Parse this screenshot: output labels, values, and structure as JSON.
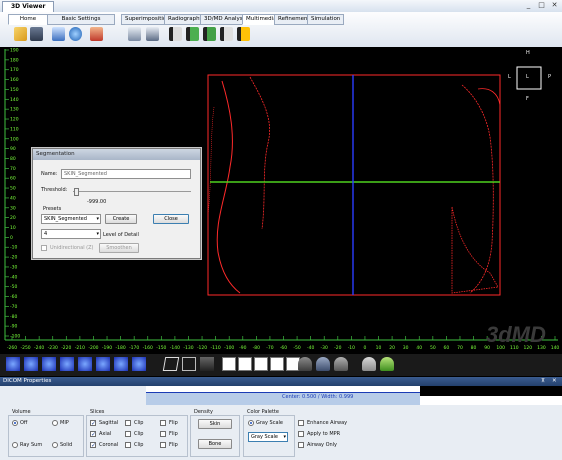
{
  "window": {
    "title": "3D Viewer",
    "minimize": "_",
    "restore": "□",
    "close": "✕"
  },
  "ribbon": {
    "tabs_left": [
      {
        "label": "Home",
        "active": true
      },
      {
        "label": "Basic Settings",
        "active": false
      }
    ],
    "tabs_right": [
      {
        "label": "Superimposition",
        "active": false
      },
      {
        "label": "Radiography",
        "active": false
      },
      {
        "label": "3D/MD Analysis",
        "active": false
      },
      {
        "label": "Multimedia",
        "active": true
      },
      {
        "label": "Refinement",
        "active": false
      },
      {
        "label": "Simulation",
        "active": false
      }
    ],
    "icons": [
      "open-folder-icon",
      "save-icon",
      "screen-icon",
      "globe-icon",
      "user-settings-icon",
      "print-icon",
      "printer-icon",
      "movie-icon",
      "movie-play-icon",
      "movie-record-icon",
      "movie-export-icon",
      "movie-edit-icon"
    ]
  },
  "viewport": {
    "x_ticks": [
      "-260",
      "-250",
      "-240",
      "-230",
      "-220",
      "-210",
      "-200",
      "-190",
      "-180",
      "-170",
      "-160",
      "-150",
      "-140",
      "-130",
      "-120",
      "-110",
      "-100",
      "-90",
      "-80",
      "-70",
      "-60",
      "-50",
      "-40",
      "-30",
      "-20",
      "-10",
      "0",
      "10",
      "20",
      "30",
      "40",
      "50",
      "60",
      "70",
      "80",
      "90",
      "100",
      "110",
      "120",
      "130",
      "140"
    ],
    "y_ticks": [
      "190",
      "180",
      "170",
      "160",
      "150",
      "140",
      "130",
      "120",
      "110",
      "100",
      "90",
      "80",
      "70",
      "60",
      "50",
      "40",
      "30",
      "20",
      "10",
      "0",
      "-10",
      "-20",
      "-30",
      "-40",
      "-50",
      "-60",
      "-70",
      "-80",
      "-90",
      "-100"
    ],
    "orientation": {
      "top": "H",
      "left": "L",
      "right": "P",
      "bottom": "F",
      "center": "L"
    },
    "watermark": "3dMD"
  },
  "segmentation": {
    "title": "Segmentation",
    "name_label": "Name:",
    "name_value": "SKIN_Segmented",
    "threshold_label": "Threshold:",
    "threshold_value": "-999.00",
    "presets_label": "Presets",
    "preset_value": "SKIN_Segmented",
    "create_label": "Create",
    "close_label": "Close",
    "lod_value": "4",
    "lod_label": "Level of Detail",
    "unidirectional_label": "Unidirectional (Z)",
    "smoothen_label": "Smoothen"
  },
  "properties": {
    "title": "DICOM Properties",
    "pin": "⊼",
    "close": "✕",
    "histogram_label": "Center: 0.500 / Width: 0.999",
    "volume": {
      "title": "Volume",
      "off": "Off",
      "mip": "MIP",
      "ray_sum": "Ray Sum",
      "solid": "Solid",
      "selected": "Off"
    },
    "slices": {
      "title": "Slices",
      "rows": [
        {
          "name": "Sagittal",
          "checked": true,
          "clip": "Clip",
          "flip": "Flip"
        },
        {
          "name": "Axial",
          "checked": true,
          "clip": "Clip",
          "flip": "Flip"
        },
        {
          "name": "Coronal",
          "checked": true,
          "clip": "Clip",
          "flip": "Flip"
        }
      ]
    },
    "density": {
      "title": "Density",
      "skin": "Skin",
      "bone": "Bone"
    },
    "palette": {
      "title": "Color Palette",
      "gray_scale": "Gray Scale",
      "selected": "Gray Scale"
    },
    "options": {
      "enhance_airway": "Enhance Airway",
      "apply_mpr": "Apply to MPR",
      "airway_only": "Airway Only"
    }
  },
  "colors": {
    "accent": "#2b4f86",
    "axis_green": "#7aff3a",
    "ruler_green": "#3fbf3f",
    "contour_red": "#ff2a2a",
    "crosshair_blue": "#2a3cff",
    "crosshair_green": "#4fd11f"
  }
}
